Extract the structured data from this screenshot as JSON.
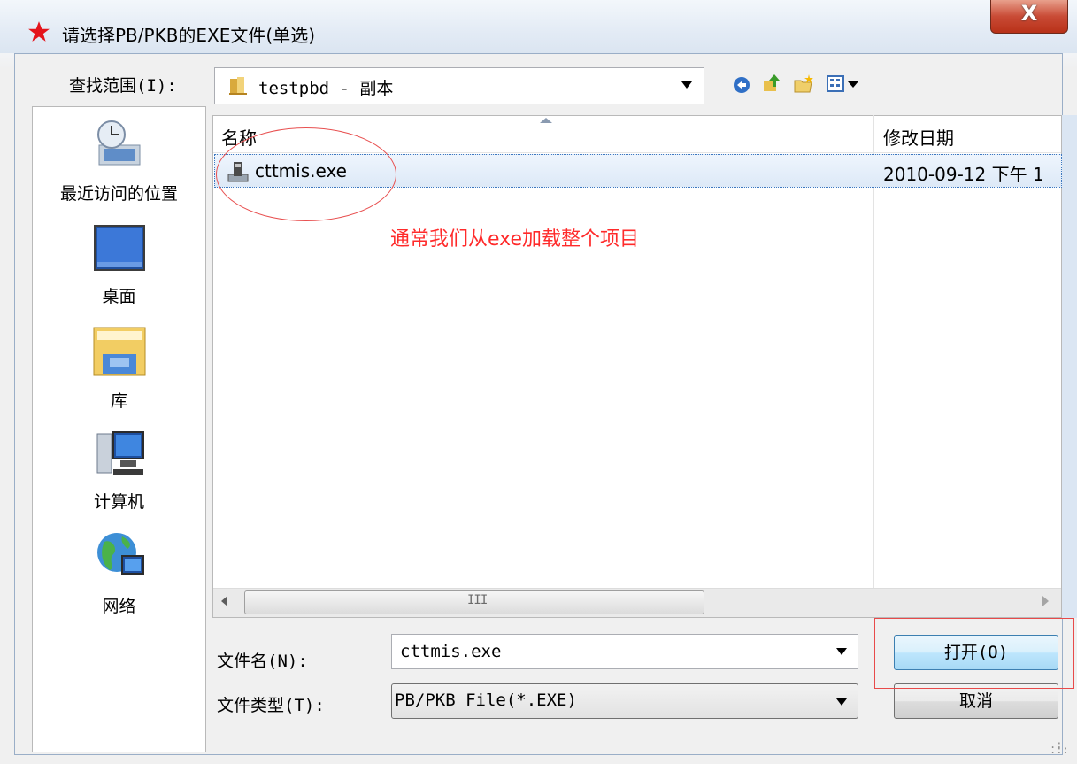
{
  "window": {
    "title": "请选择PB/PKB的EXE文件(单选)",
    "close_label": "X"
  },
  "lookin": {
    "label": "查找范围(I):",
    "value": "testpbd - 副本"
  },
  "toolbar": {
    "icons": [
      "back-icon",
      "up-folder-icon",
      "new-folder-icon",
      "view-menu-icon"
    ]
  },
  "places": [
    {
      "label": "最近访问的位置",
      "icon": "recent-places-icon"
    },
    {
      "label": "桌面",
      "icon": "desktop-icon"
    },
    {
      "label": "库",
      "icon": "libraries-icon"
    },
    {
      "label": "计算机",
      "icon": "computer-icon"
    },
    {
      "label": "网络",
      "icon": "network-icon"
    }
  ],
  "filelist": {
    "columns": [
      "名称",
      "修改日期"
    ],
    "rows": [
      {
        "name": "cttmis.exe",
        "date": "2010-09-12 下午 1"
      }
    ],
    "scroll_grip": "III"
  },
  "annotation": {
    "text": "通常我们从exe加载整个项目",
    "color": "#ff2a2a"
  },
  "filename": {
    "label": "文件名(N):",
    "value": "cttmis.exe"
  },
  "filetype": {
    "label": "文件类型(T):",
    "value": "PB/PKB File(*.EXE)"
  },
  "buttons": {
    "open": "打开(O)",
    "cancel": "取消"
  }
}
